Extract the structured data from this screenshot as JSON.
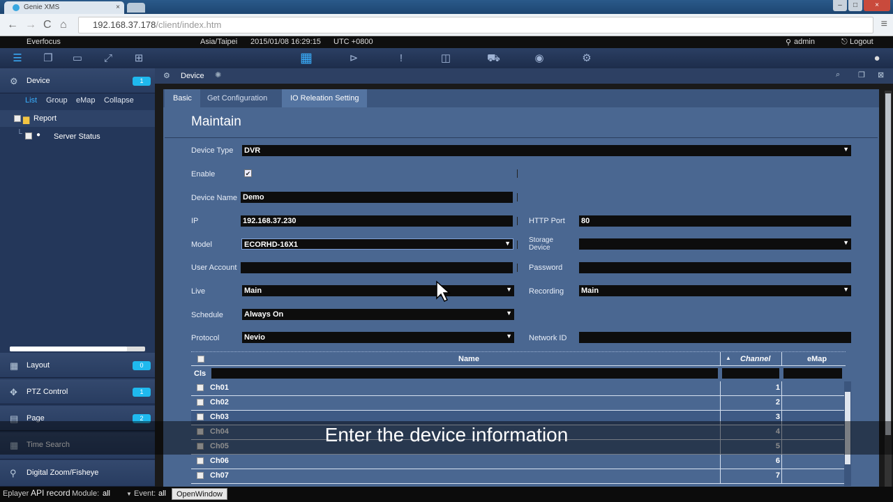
{
  "browser": {
    "tab_title": "Genie XMS",
    "url_host": "192.168.37.178",
    "url_path": "/client/index.htm",
    "nav_back": "←",
    "nav_forward": "→",
    "nav_reload": "C",
    "nav_home": "⌂",
    "menu_icon": "≡",
    "win_min": "–",
    "win_max": "□",
    "win_close": "×"
  },
  "infobar": {
    "brand": "Everfocus",
    "timezone": "Asia/Taipei",
    "datetime": "2015/01/08 16:29:15",
    "utc": "UTC +0800",
    "user": "admin",
    "logout": "Logout"
  },
  "sidebar": {
    "device": {
      "label": "Device",
      "badge": "1"
    },
    "tabs": [
      "List",
      "Group",
      "eMap",
      "Collapse"
    ],
    "tree": {
      "root": "Report",
      "child": "Server Status"
    },
    "sections": [
      {
        "label": "Layout",
        "badge": "0"
      },
      {
        "label": "PTZ Control",
        "badge": "1"
      },
      {
        "label": "Page",
        "badge": "2"
      },
      {
        "label": "Time Search"
      },
      {
        "label": "Digital Zoom/Fisheye"
      }
    ]
  },
  "main": {
    "title": "Device",
    "tabs": [
      "Basic",
      "Get Configuration",
      "IO Releation Setting"
    ],
    "heading": "Maintain",
    "form": {
      "device_type_label": "Device Type",
      "device_type_value": "DVR",
      "enable_label": "Enable",
      "device_name_label": "Device Name",
      "device_name_value": "Demo",
      "ip_label": "IP",
      "ip_value": "192.168.37.230",
      "http_port_label": "HTTP Port",
      "http_port_value": "80",
      "model_label": "Model",
      "model_value": "ECORHD-16X1",
      "storage_label_1": "Storage",
      "storage_label_2": "Device",
      "storage_value": "",
      "user_account_label": "User Account",
      "user_account_value": "",
      "password_label": "Password",
      "password_value": "",
      "live_label": "Live",
      "live_value": "Main",
      "recording_label": "Recording",
      "recording_value": "Main",
      "schedule_label": "Schedule",
      "schedule_value": "Always On",
      "protocol_label": "Protocol",
      "protocol_value": "Nevio",
      "network_id_label": "Network ID",
      "network_id_value": ""
    },
    "grid": {
      "headers": {
        "name": "Name",
        "channel": "Channel",
        "emap": "eMap"
      },
      "filter_label": "Cls",
      "rows": [
        {
          "name": "Ch01",
          "channel": "1"
        },
        {
          "name": "Ch02",
          "channel": "2"
        },
        {
          "name": "Ch03",
          "channel": "3"
        },
        {
          "name": "Ch04",
          "channel": "4"
        },
        {
          "name": "Ch05",
          "channel": "5"
        },
        {
          "name": "Ch06",
          "channel": "6"
        },
        {
          "name": "Ch07",
          "channel": "7"
        }
      ]
    }
  },
  "caption": "Enter the device information",
  "bottombar": {
    "eplayer": "Eplayer",
    "api": "API record",
    "module_label": "Module:",
    "module_value": "all",
    "event_label": "Event:",
    "event_value": "all",
    "open_window": "OpenWindow"
  },
  "colors": {
    "accent": "#1fb9ee",
    "panel": "#4a6791",
    "sidebar": "#24375a"
  }
}
